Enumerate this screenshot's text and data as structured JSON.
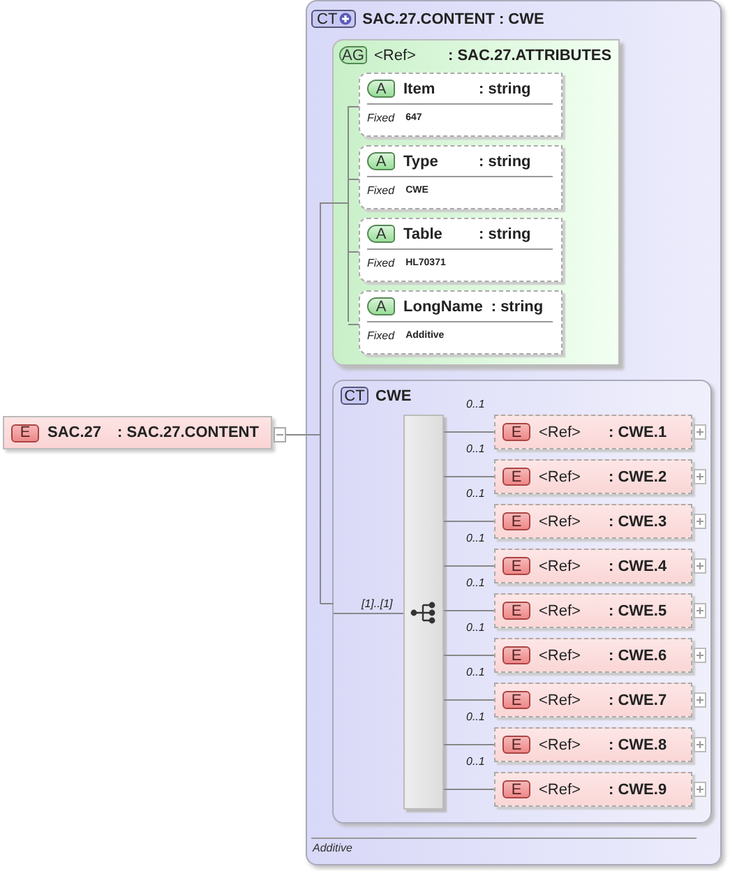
{
  "root": {
    "badge": "E",
    "name": "SAC.27",
    "type": ": SAC.27.CONTENT",
    "expanded": true
  },
  "complex_type": {
    "badge": "CT",
    "title": "SAC.27.CONTENT : CWE",
    "attribute_group": {
      "badge": "AG",
      "ref": "<Ref>",
      "type": ": SAC.27.ATTRIBUTES",
      "attributes": [
        {
          "badge": "A",
          "name": "Item",
          "type": ": string",
          "fixed_label": "Fixed",
          "fixed_value": "647"
        },
        {
          "badge": "A",
          "name": "Type",
          "type": ": string",
          "fixed_label": "Fixed",
          "fixed_value": "CWE"
        },
        {
          "badge": "A",
          "name": "Table",
          "type": ": string",
          "fixed_label": "Fixed",
          "fixed_value": "HL70371"
        },
        {
          "badge": "A",
          "name": "LongName",
          "type": ": string",
          "fixed_label": "Fixed",
          "fixed_value": "Additive"
        }
      ]
    },
    "content": {
      "badge": "CT",
      "title": "CWE",
      "sequence": {
        "occurrence": "[1]..[1]",
        "elements": [
          {
            "occurrence": "0..1",
            "badge": "E",
            "ref": "<Ref>",
            "type": ": CWE.1",
            "expanded": false
          },
          {
            "occurrence": "0..1",
            "badge": "E",
            "ref": "<Ref>",
            "type": ": CWE.2",
            "expanded": false
          },
          {
            "occurrence": "0..1",
            "badge": "E",
            "ref": "<Ref>",
            "type": ": CWE.3",
            "expanded": false
          },
          {
            "occurrence": "0..1",
            "badge": "E",
            "ref": "<Ref>",
            "type": ": CWE.4",
            "expanded": false
          },
          {
            "occurrence": "0..1",
            "badge": "E",
            "ref": "<Ref>",
            "type": ": CWE.5",
            "expanded": false
          },
          {
            "occurrence": "0..1",
            "badge": "E",
            "ref": "<Ref>",
            "type": ": CWE.6",
            "expanded": false
          },
          {
            "occurrence": "0..1",
            "badge": "E",
            "ref": "<Ref>",
            "type": ": CWE.7",
            "expanded": false
          },
          {
            "occurrence": "0..1",
            "badge": "E",
            "ref": "<Ref>",
            "type": ": CWE.8",
            "expanded": false
          },
          {
            "occurrence": "0..1",
            "badge": "E",
            "ref": "<Ref>",
            "type": ": CWE.9",
            "expanded": false
          }
        ]
      }
    },
    "documentation": "Additive"
  }
}
